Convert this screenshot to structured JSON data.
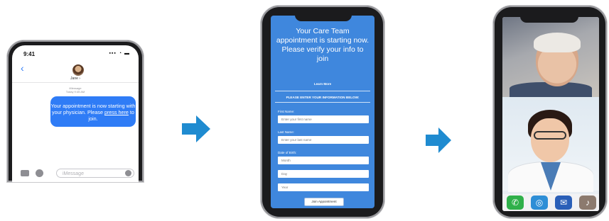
{
  "phone1": {
    "time": "9:41",
    "status": "▪▪▪ ◔ ▬",
    "back": "‹",
    "contact_name": "Jane ›",
    "meta_line1": "iMessage",
    "meta_line2": "Today 9:45 AM",
    "message_part1": "Your appointment is now starting with your physician. Please ",
    "message_link": "press here",
    "message_part2": " to join.",
    "input_placeholder": "iMessage",
    "accent": "#2f7cf6"
  },
  "arrows": {
    "color": "#1f8bd0"
  },
  "phone2": {
    "title": "Your Care Team appointment is starting now. Please verify your info to join",
    "learn_more": "Learn More",
    "instruction": "PLEASE ENTER YOUR INFORMATION BELOW:",
    "first_name_label": "First Name:",
    "first_name_placeholder": "Enter your first name",
    "last_name_label": "Last Name:",
    "last_name_placeholder": "Enter your last name",
    "dob_label": "Date of Birth:",
    "month": "Month",
    "day": "Day",
    "year": "Year",
    "join_button": "Join Appointment",
    "background": "#3f87dd"
  },
  "phone3": {
    "icons": [
      {
        "name": "phone-icon",
        "glyph": "✆",
        "color": "#2fb04a"
      },
      {
        "name": "globe-icon",
        "glyph": "◎",
        "color": "#2d8ed6"
      },
      {
        "name": "mail-icon",
        "glyph": "✉",
        "color": "#2a5fb8"
      },
      {
        "name": "microphone-icon",
        "glyph": "♪",
        "color": "#8c7a6e"
      }
    ]
  }
}
